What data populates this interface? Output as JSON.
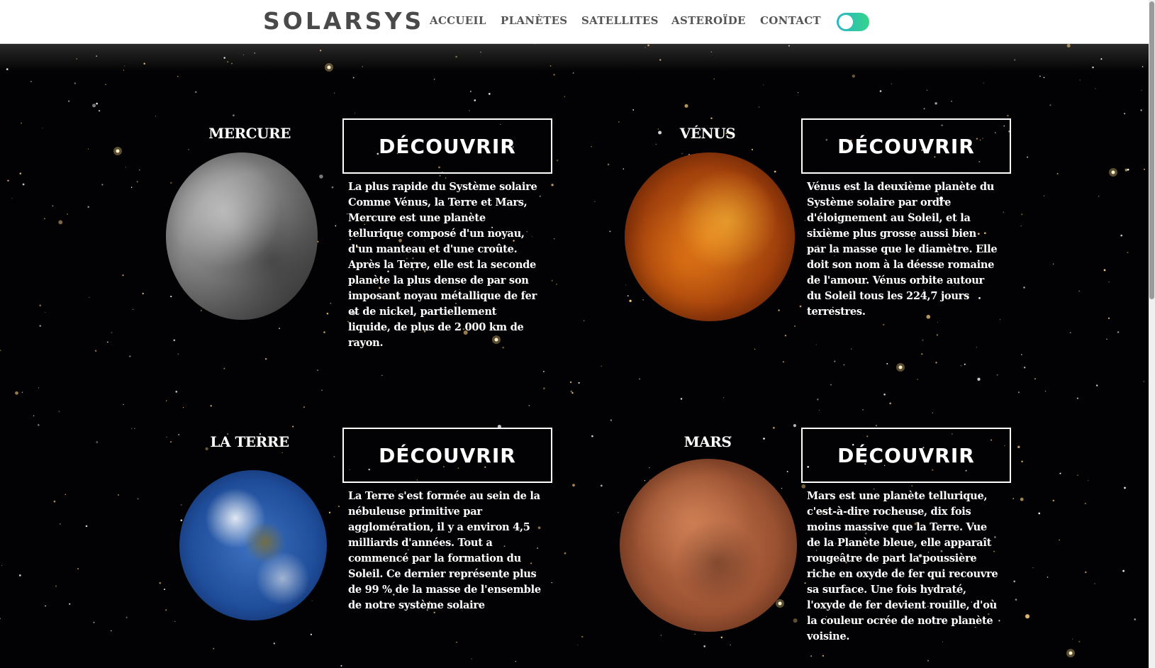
{
  "header": {
    "logo": "SOLARSYS",
    "nav": [
      "ACCUEIL",
      "PLANÈTES",
      "SATELLITES",
      "ASTEROÏDE",
      "CONTACT"
    ]
  },
  "colors": {
    "toggle_from": "#2bb5c8",
    "toggle_to": "#36d48a",
    "background": "#020204",
    "text": "#ffffff"
  },
  "planets": [
    {
      "name": "MERCURE",
      "button": "DÉCOUVRIR",
      "description": "La plus rapide du Système solaire Comme Vénus, la Terre et Mars, Mercure est une planète tellurique composé d'un noyau, d'un manteau et d'une croûte. Après la Terre, elle est la seconde planète la plus dense de par son imposant noyau métallique de fer et de nickel, partiellement liquide, de plus de 2 000 km de rayon."
    },
    {
      "name": "VÉNUS",
      "button": "DÉCOUVRIR",
      "description": "Vénus est la deuxième planète du Système solaire par ordre d'éloignement au Soleil, et la sixième plus grosse aussi bien par la masse que le diamètre. Elle doit son nom à la déesse romaine de l'amour. Vénus orbite autour du Soleil tous les 224,7 jours terrestres."
    },
    {
      "name": "LA TERRE",
      "button": "DÉCOUVRIR",
      "description": "La Terre s'est formée au sein de la nébuleuse primitive par agglomération, il y a environ 4,5 milliards d'années. Tout a commencé par la formation du Soleil. Ce dernier représente plus de 99 % de la masse de l'ensemble de notre système solaire"
    },
    {
      "name": "MARS",
      "button": "DÉCOUVRIR",
      "description": "Mars est une planète tellurique, c'est-à-dire rocheuse, dix fois moins massive que la Terre. Vue de la Planète bleue, elle apparaît rougeâtre de part la poussière riche en oxyde de fer qui recouvre sa surface. Une fois hydraté, l'oxyde de fer devient rouille, d'où la couleur ocrée de notre planète voisine."
    }
  ]
}
